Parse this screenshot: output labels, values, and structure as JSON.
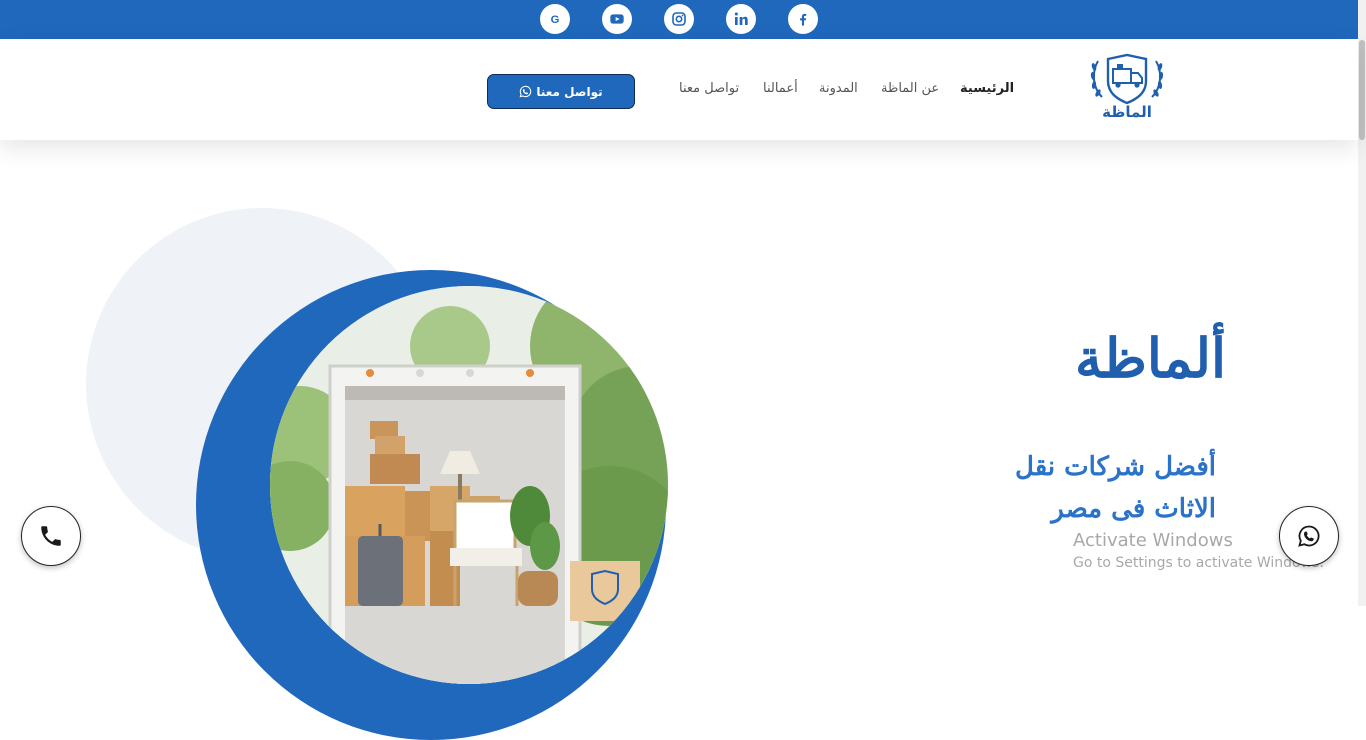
{
  "colors": {
    "primary": "#1f68bc",
    "dark_border": "#0e2c55",
    "circle_bg": "#eff2f6"
  },
  "social_icons": [
    "google-icon",
    "youtube-icon",
    "instagram-icon",
    "linkedin-icon",
    "facebook-icon"
  ],
  "header": {
    "logo_text": "الماظة",
    "nav": {
      "home": "الرئيسية",
      "about": "عن الماظة",
      "blog": "المدونة",
      "works": "أعمالنا",
      "contact": "تواصل معنا"
    },
    "cta_label": "تواصل معنا"
  },
  "hero": {
    "brand": "ألماظة",
    "tagline": "أفضل شركات نقل الاثاث فى مصر"
  },
  "watermark": {
    "line1": "Activate Windows",
    "line2": "Go to Settings to activate Windows."
  },
  "floating": {
    "left_icon": "phone-icon",
    "right_icon": "whatsapp-icon"
  }
}
